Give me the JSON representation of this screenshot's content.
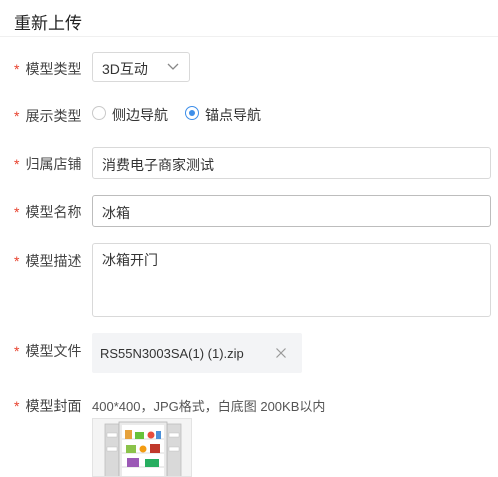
{
  "dialog": {
    "title": "重新上传"
  },
  "form": {
    "required_mark": "*",
    "model_type": {
      "label": "模型类型",
      "value": "3D互动",
      "icon": "chevron-down-icon"
    },
    "display_type": {
      "label": "展示类型",
      "options": [
        {
          "label": "侧边导航",
          "checked": false
        },
        {
          "label": "锚点导航",
          "checked": true
        }
      ]
    },
    "store": {
      "label": "归属店铺",
      "value": "消费电子商家测试"
    },
    "model_name": {
      "label": "模型名称",
      "value": "冰箱"
    },
    "model_desc": {
      "label": "模型描述",
      "value": "冰箱开门"
    },
    "model_file": {
      "label": "模型文件",
      "file_name": "RS55N3003SA(1) (1).zip",
      "remove_icon": "close-icon"
    },
    "model_cover": {
      "label": "模型封面",
      "hint": "400*400，JPG格式，白底图 200KB以内"
    }
  },
  "colors": {
    "accent": "#3d8ee9",
    "required": "#e8412d"
  }
}
